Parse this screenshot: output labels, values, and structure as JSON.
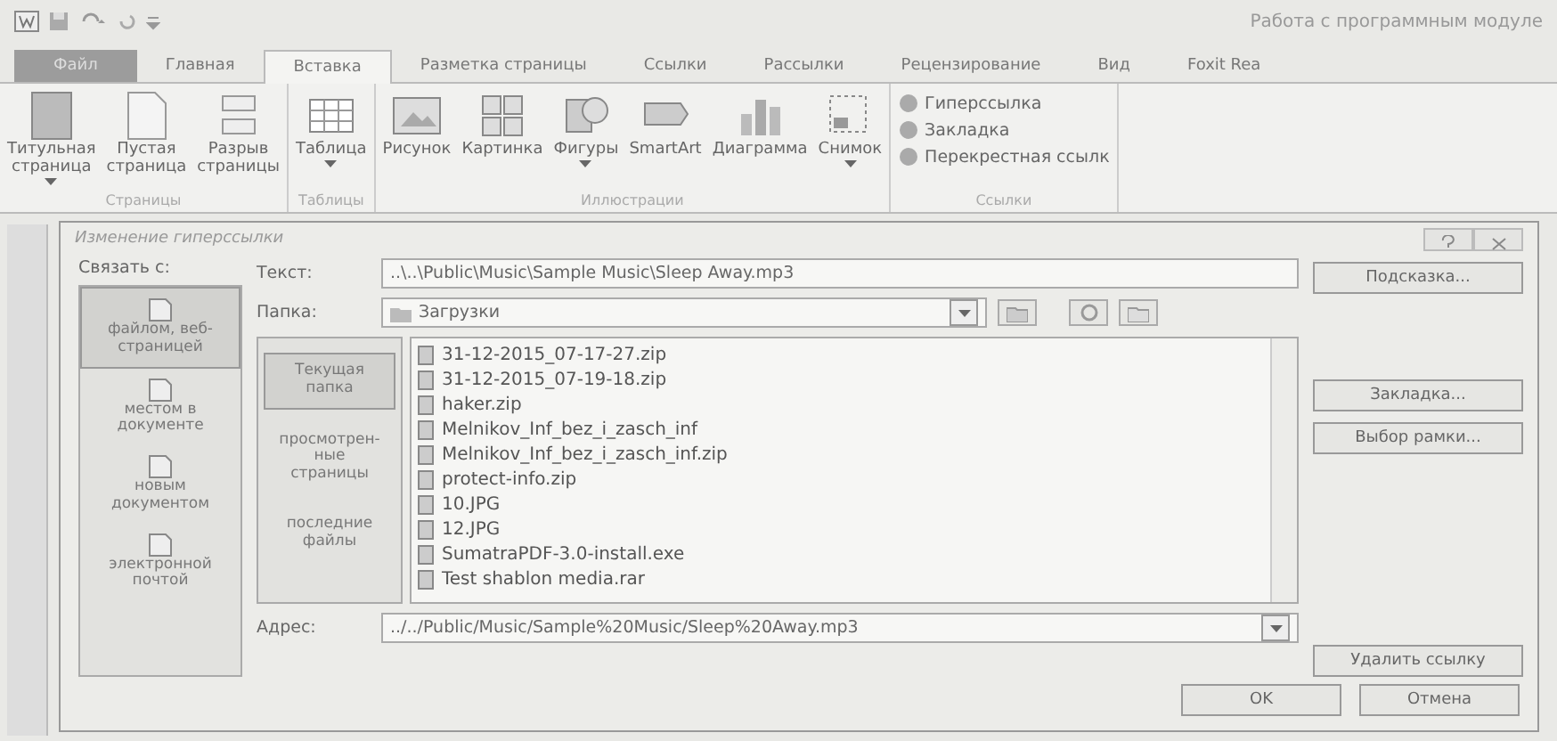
{
  "window": {
    "context_title": "Работа с программным модуле"
  },
  "tabs": [
    {
      "label": "Файл",
      "selected": false,
      "kind": "file"
    },
    {
      "label": "Главная",
      "selected": false,
      "kind": "tab"
    },
    {
      "label": "Вставка",
      "selected": true,
      "kind": "tab"
    },
    {
      "label": "Разметка страницы",
      "selected": false,
      "kind": "tab"
    },
    {
      "label": "Ссылки",
      "selected": false,
      "kind": "tab"
    },
    {
      "label": "Рассылки",
      "selected": false,
      "kind": "tab"
    },
    {
      "label": "Рецензирование",
      "selected": false,
      "kind": "tab"
    },
    {
      "label": "Вид",
      "selected": false,
      "kind": "tab"
    },
    {
      "label": "Foxit Rea",
      "selected": false,
      "kind": "tab"
    }
  ],
  "ribbon": {
    "groups": [
      {
        "title": "Страницы",
        "kind": "large",
        "items": [
          {
            "lines": [
              "Титульная",
              "страница"
            ],
            "dropdown": true
          },
          {
            "lines": [
              "Пустая",
              "страница"
            ],
            "dropdown": false
          },
          {
            "lines": [
              "Разрыв",
              "страницы"
            ],
            "dropdown": false
          }
        ]
      },
      {
        "title": "Таблицы",
        "kind": "large",
        "items": [
          {
            "lines": [
              "Таблица"
            ],
            "dropdown": true
          }
        ]
      },
      {
        "title": "Иллюстрации",
        "kind": "large",
        "items": [
          {
            "lines": [
              "Рисунок"
            ],
            "dropdown": false
          },
          {
            "lines": [
              "Картинка"
            ],
            "dropdown": false
          },
          {
            "lines": [
              "Фигуры"
            ],
            "dropdown": true
          },
          {
            "lines": [
              "SmartArt"
            ],
            "dropdown": false
          },
          {
            "lines": [
              "Диаграмма"
            ],
            "dropdown": false
          },
          {
            "lines": [
              "Снимок"
            ],
            "dropdown": true
          }
        ]
      },
      {
        "title": "Ссылки",
        "kind": "small",
        "items": [
          {
            "lines": [
              "Гиперссылка"
            ]
          },
          {
            "lines": [
              "Закладка"
            ]
          },
          {
            "lines": [
              "Перекрестная ссылк"
            ]
          }
        ]
      }
    ]
  },
  "dialog": {
    "title": "Изменение гиперссылки",
    "link_to_label": "Связать с:",
    "link_targets": [
      {
        "lines": [
          "файлом, веб-",
          "страницей"
        ],
        "selected": true
      },
      {
        "lines": [
          "местом в",
          "документе"
        ],
        "selected": false
      },
      {
        "lines": [
          "новым",
          "документом"
        ],
        "selected": false
      },
      {
        "lines": [
          "электронной",
          "почтой"
        ],
        "selected": false
      }
    ],
    "text_label": "Текст:",
    "text_value": "..\\..\\Public\\Music\\Sample Music\\Sleep Away.mp3",
    "tooltip_button": "Подсказка...",
    "folder_label": "Папка:",
    "folder_value": "Загрузки",
    "browse_tabs": [
      {
        "lines": [
          "Текущая",
          "папка"
        ],
        "selected": true
      },
      {
        "lines": [
          "просмотрен-",
          "ные",
          "страницы"
        ],
        "selected": false
      },
      {
        "lines": [
          "последние",
          "файлы"
        ],
        "selected": false
      }
    ],
    "files": [
      "31-12-2015_07-17-27.zip",
      "31-12-2015_07-19-18.zip",
      "haker.zip",
      "Melnikov_Inf_bez_i_zasch_inf",
      "Melnikov_Inf_bez_i_zasch_inf.zip",
      "protect-info.zip",
      "10.JPG",
      "12.JPG",
      "SumatraPDF-3.0-install.exe",
      "Test shablon media.rar"
    ],
    "bookmark_button": "Закладка...",
    "frame_button": "Выбор рамки...",
    "address_label": "Адрес:",
    "address_value": "../../Public/Music/Sample%20Music/Sleep%20Away.mp3",
    "remove_button": "Удалить ссылку",
    "ok_button": "OK",
    "cancel_button": "Отмена"
  }
}
